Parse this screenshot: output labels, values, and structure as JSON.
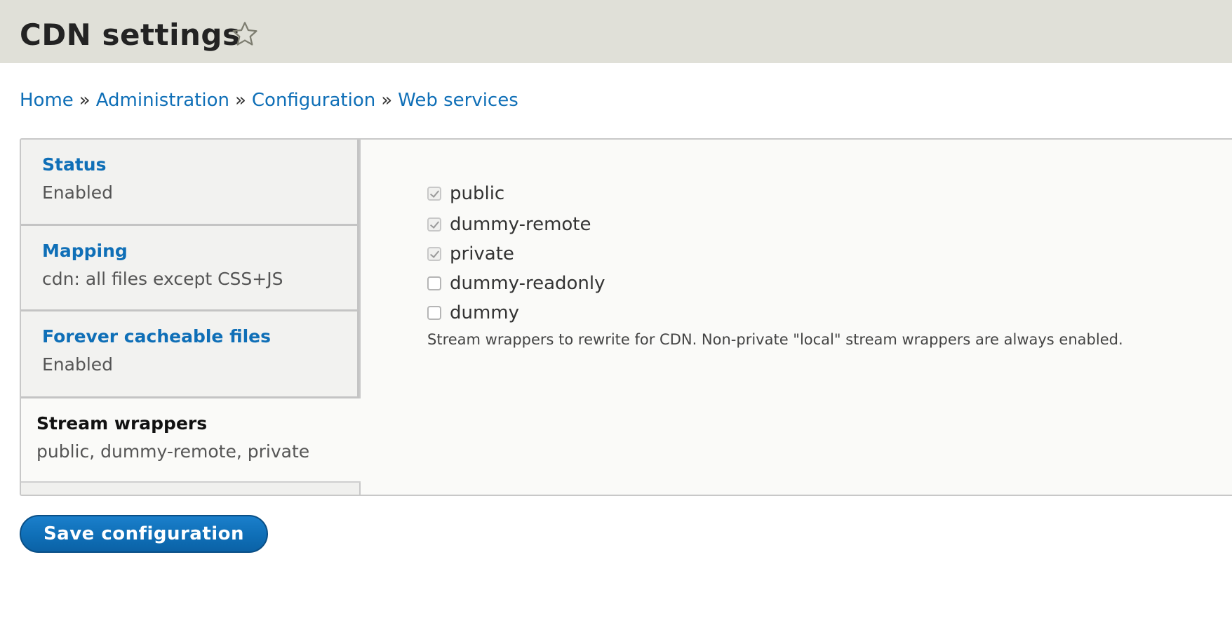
{
  "header": {
    "title": "CDN settings",
    "favorite_icon": "star-outline-icon"
  },
  "breadcrumb": {
    "items": [
      "Home",
      "Administration",
      "Configuration",
      "Web services"
    ],
    "separator": "»"
  },
  "tabs": [
    {
      "title": "Status",
      "summary": "Enabled",
      "active": false
    },
    {
      "title": "Mapping",
      "summary": "cdn: all files except CSS+JS",
      "active": false
    },
    {
      "title": "Forever cacheable files",
      "summary": "Enabled",
      "active": false
    },
    {
      "title": "Stream wrappers",
      "summary": "public, dummy-remote, private",
      "active": true
    }
  ],
  "stream_wrappers": {
    "options": [
      {
        "label": "public",
        "checked": true,
        "disabled": true
      },
      {
        "label": "dummy-remote",
        "checked": true,
        "disabled": true
      },
      {
        "label": "private",
        "checked": true,
        "disabled": true
      },
      {
        "label": "dummy-readonly",
        "checked": false,
        "disabled": false
      },
      {
        "label": "dummy",
        "checked": false,
        "disabled": false
      }
    ],
    "description": "Stream wrappers to rewrite for CDN. Non-private \"local\" stream wrappers are always enabled."
  },
  "actions": {
    "save_label": "Save configuration"
  },
  "colors": {
    "link": "#0f6fb7",
    "header_bg": "#e0e0d8",
    "button_bg": "#0f6fb7"
  }
}
